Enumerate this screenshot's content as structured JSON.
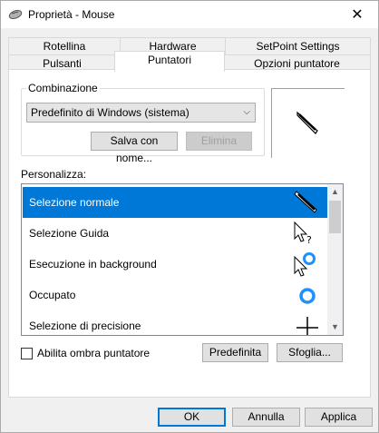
{
  "window": {
    "title": "Proprietà - Mouse",
    "close_glyph": "✕"
  },
  "tabs_row1": [
    {
      "label": "Rotellina"
    },
    {
      "label": "Hardware"
    },
    {
      "label": "SetPoint Settings"
    }
  ],
  "tabs_row2": [
    {
      "label": "Pulsanti"
    },
    {
      "label": "Puntatori",
      "active": true
    },
    {
      "label": "Opzioni puntatore"
    }
  ],
  "scheme": {
    "group_label": "Combinazione",
    "selected": "Predefinito di Windows (sistema)",
    "save_as_label": "Salva con nome...",
    "delete_label": "Elimina"
  },
  "customize": {
    "label": "Personalizza:",
    "items": [
      {
        "label": "Selezione normale",
        "icon": "normal-select-cursor",
        "selected": true
      },
      {
        "label": "Selezione Guida",
        "icon": "help-select-cursor"
      },
      {
        "label": "Esecuzione in background",
        "icon": "working-in-background-cursor"
      },
      {
        "label": "Occupato",
        "icon": "busy-cursor"
      },
      {
        "label": "Selezione di precisione",
        "icon": "precision-select-cursor"
      }
    ]
  },
  "shadow_checkbox": {
    "label": "Abilita ombra puntatore",
    "checked": false
  },
  "buttons": {
    "default_label": "Predefinita",
    "browse_label": "Sfoglia...",
    "ok_label": "OK",
    "cancel_label": "Annulla",
    "apply_label": "Applica"
  },
  "colors": {
    "accent": "#0078d7",
    "busy_ring": "#1e90ff"
  }
}
